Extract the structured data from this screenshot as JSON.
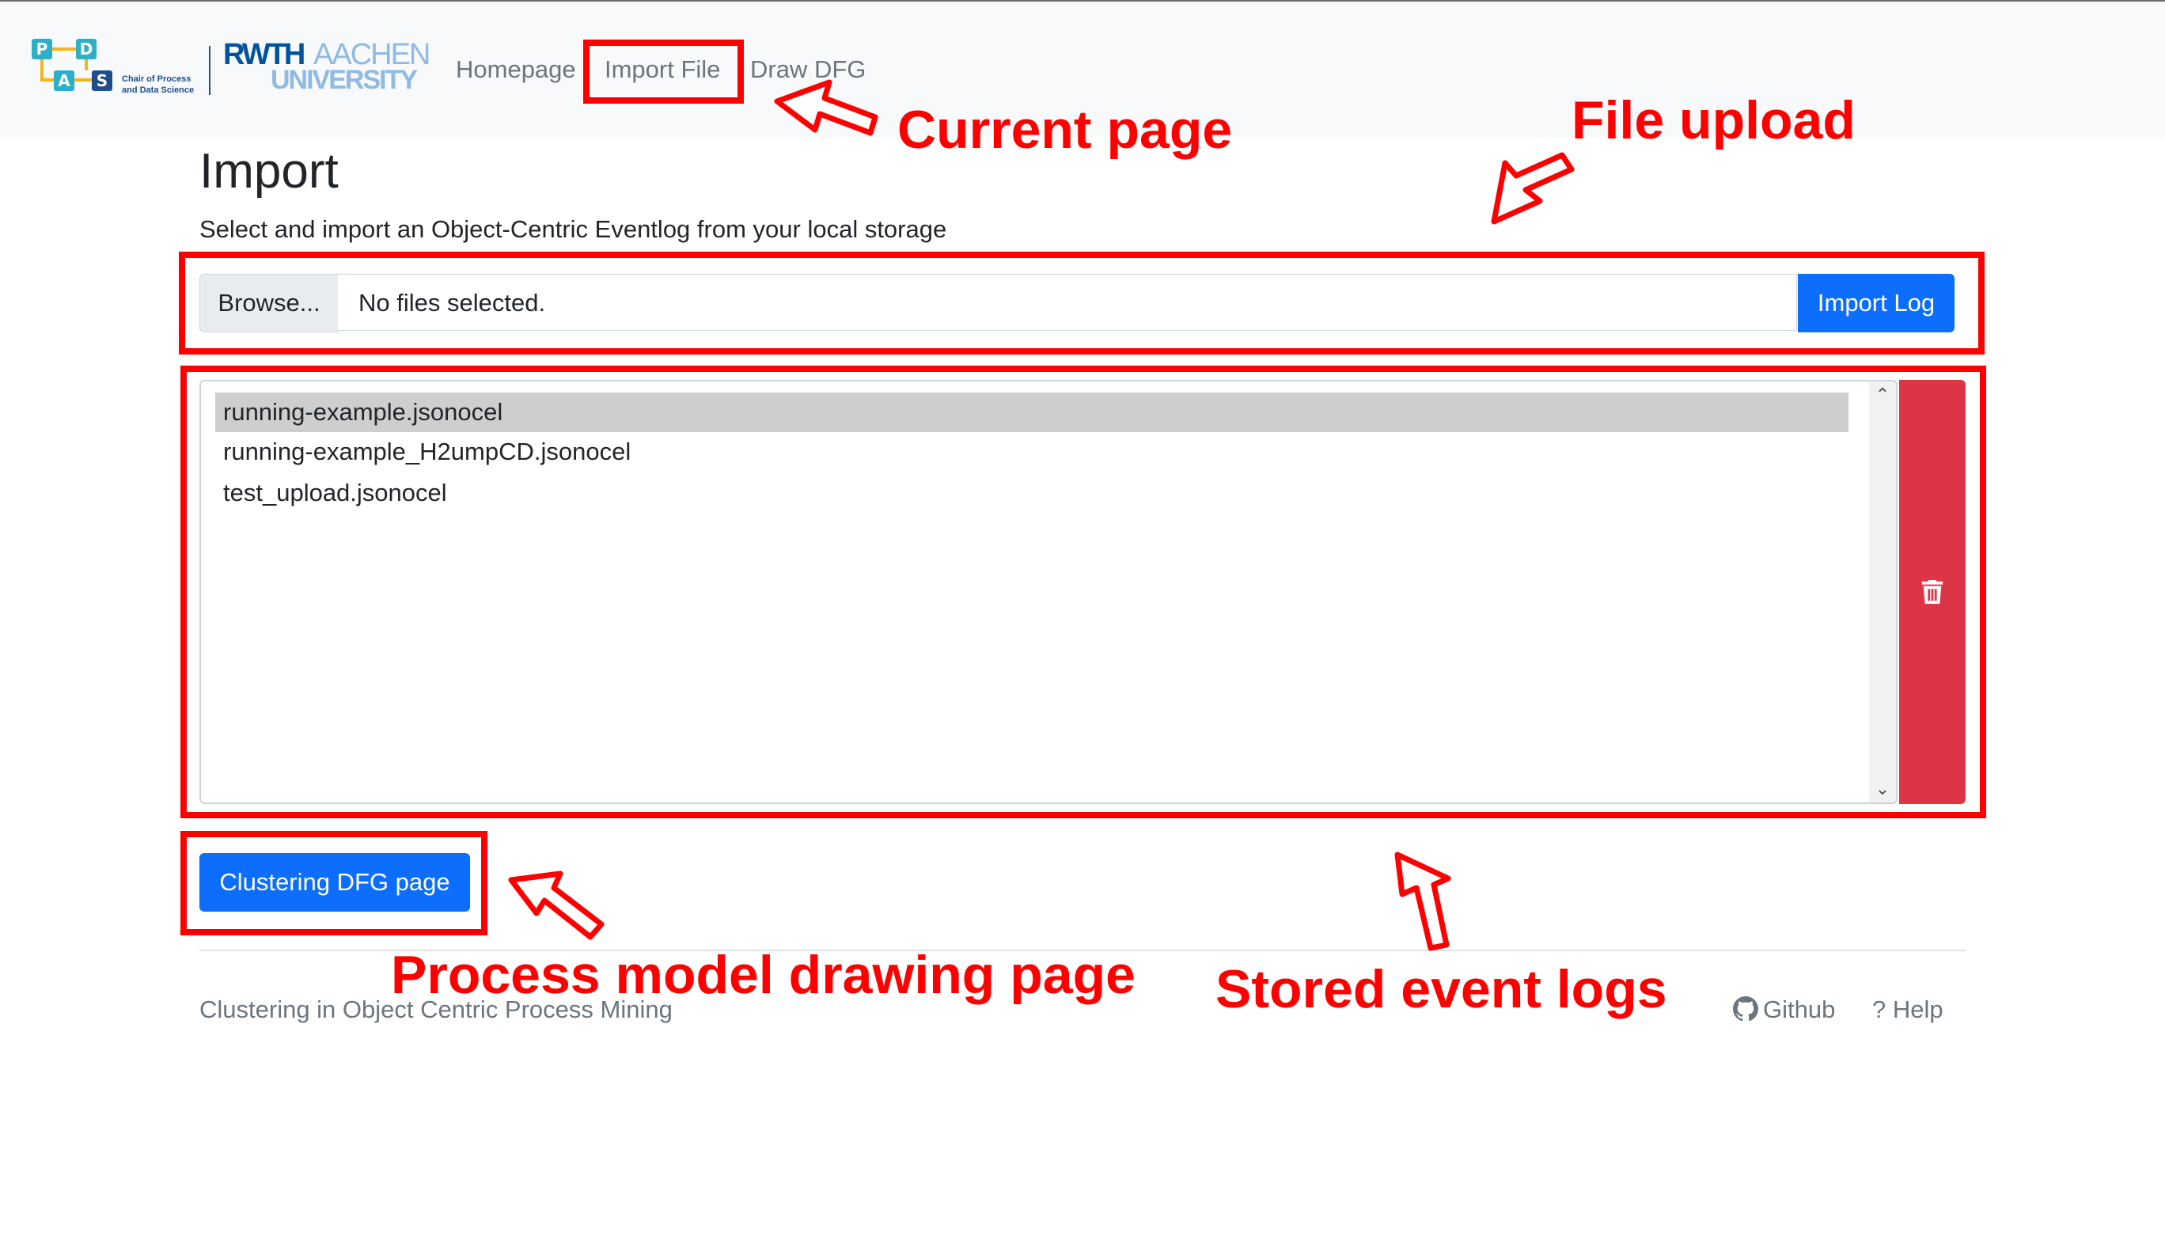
{
  "navbar": {
    "pads_logo": {
      "letters": [
        "P",
        "D",
        "A",
        "S"
      ],
      "text": "Chair of Process\nand Data Science"
    },
    "rwth_logo": {
      "bold": "RWTH",
      "light": "AACHEN",
      "university": "UNIVERSITY"
    },
    "links": [
      "Homepage",
      "Import File",
      "Draw DFG"
    ],
    "active": "Import File"
  },
  "main": {
    "title": "Import",
    "subtitle": "Select and import an Object-Centric Eventlog from your local storage",
    "file_input": {
      "browse_label": "Browse...",
      "status": "No files selected.",
      "import_button": "Import Log"
    },
    "stored_logs": {
      "items": [
        "running-example.jsonocel",
        "running-example_H2umpCD.jsonocel",
        "test_upload.jsonocel"
      ],
      "selected_index": 0,
      "delete_icon": "trash-icon"
    },
    "cluster_button": "Clustering DFG page"
  },
  "footer": {
    "text": "Clustering in Object Centric Process Mining",
    "github_label": "Github",
    "help_label": "? Help"
  },
  "annotations": {
    "current_page": "Current page",
    "file_upload": "File upload",
    "process_model": "Process model drawing page",
    "stored_event_logs": "Stored event logs",
    "color": "#ff0000"
  },
  "colors": {
    "primary": "#0d6efd",
    "danger": "#dc3545",
    "navbar_bg": "#f8f9fa",
    "selected_row": "#cecece"
  }
}
